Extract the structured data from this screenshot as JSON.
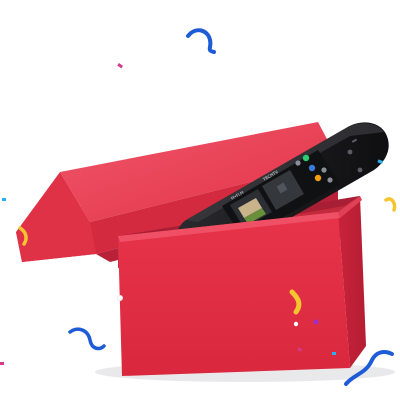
{
  "scene": {
    "background_color": "#ffffff",
    "box_color": "#e8344a",
    "box_shade_color": "#c8233a",
    "box_highlight_color": "#f0566a",
    "remote_body_color": "#1b1b1e",
    "remote_bezel_color": "#2a2a2e",
    "screen_color": "#101214"
  },
  "remote_screen": {
    "card_1_label": "M•FLM",
    "card_2_label": "TECHTV"
  },
  "confetti": {
    "colors": [
      "#1e5bd6",
      "#f5c531",
      "#2ab0f0",
      "#d43a8b",
      "#9b2fc9"
    ]
  }
}
